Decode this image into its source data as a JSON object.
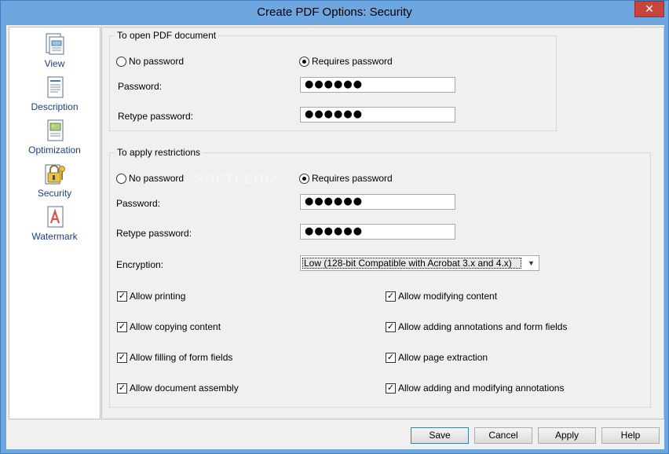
{
  "window": {
    "title": "Create PDF Options: Security",
    "close_glyph": "✕"
  },
  "sidebar": {
    "items": [
      {
        "label": "View",
        "icon": "view-icon"
      },
      {
        "label": "Description",
        "icon": "description-icon"
      },
      {
        "label": "Optimization",
        "icon": "optimization-icon"
      },
      {
        "label": "Security",
        "icon": "security-icon",
        "selected": true
      },
      {
        "label": "Watermark",
        "icon": "watermark-icon"
      }
    ]
  },
  "open_group": {
    "title": "To open PDF document",
    "no_password_label": "No password",
    "requires_password_label": "Requires password",
    "selected": "requires_password",
    "password_label": "Password:",
    "password_value": "●●●●●●",
    "retype_label": "Retype password:",
    "retype_value": "●●●●●●"
  },
  "restrict_group": {
    "title": "To apply restrictions",
    "no_password_label": "No password",
    "requires_password_label": "Requires password",
    "selected": "requires_password",
    "password_label": "Password:",
    "password_value": "●●●●●●",
    "retype_label": "Retype password:",
    "retype_value": "●●●●●●",
    "encryption_label": "Encryption:",
    "encryption_value": "Low (128-bit Compatible with Acrobat 3.x and 4.x)",
    "permissions": [
      {
        "label": "Allow printing",
        "checked": true
      },
      {
        "label": "Allow modifying content",
        "checked": true
      },
      {
        "label": "Allow copying content",
        "checked": true
      },
      {
        "label": "Allow adding annotations and form fields",
        "checked": true
      },
      {
        "label": "Allow filling of form fields",
        "checked": true
      },
      {
        "label": "Allow page extraction",
        "checked": true
      },
      {
        "label": "Allow document assembly",
        "checked": true
      },
      {
        "label": "Allow adding and modifying annotations",
        "checked": true
      }
    ]
  },
  "buttons": {
    "save": "Save",
    "cancel": "Cancel",
    "apply": "Apply",
    "help": "Help"
  },
  "watermark_text": "SOFTPEDIA",
  "colors": {
    "titlebar": "#6ea6e0",
    "close": "#c7453a",
    "sidebar_text": "#1d3f7d"
  }
}
